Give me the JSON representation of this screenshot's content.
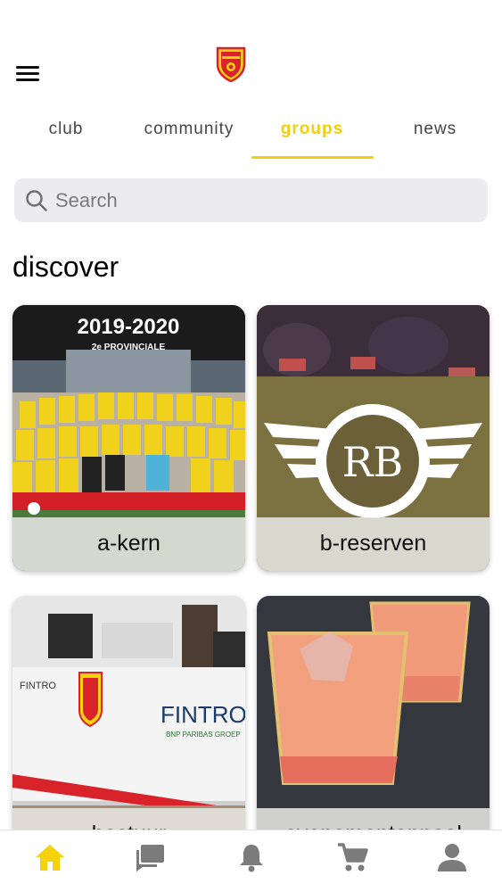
{
  "tabs": [
    {
      "label": "club"
    },
    {
      "label": "community"
    },
    {
      "label": "groups"
    },
    {
      "label": "news"
    }
  ],
  "active_tab": "groups",
  "search": {
    "placeholder": "Search"
  },
  "section_title": "discover",
  "cards": [
    {
      "label": "a-kern",
      "image_caption": "2019-2020",
      "image_subcaption": "2e PROVINCIALE"
    },
    {
      "label": "b-reserven",
      "image_emblem_text": "RB"
    },
    {
      "label": "bestuur",
      "image_text": "FINTRO",
      "image_subtext": "BNP PARIBAS GROEP"
    },
    {
      "label": "evenementenpool"
    }
  ],
  "icons": {
    "menu": "hamburger-menu-icon",
    "logo": "club-crest-logo",
    "search": "search-icon",
    "nav": [
      "home-icon",
      "chat-icon",
      "bell-icon",
      "cart-icon",
      "user-icon"
    ]
  },
  "colors": {
    "accent": "#f2cf0a",
    "crest_red": "#d8232a",
    "crest_yellow": "#f5d20c",
    "inactive_icon": "#7b7b7b"
  }
}
